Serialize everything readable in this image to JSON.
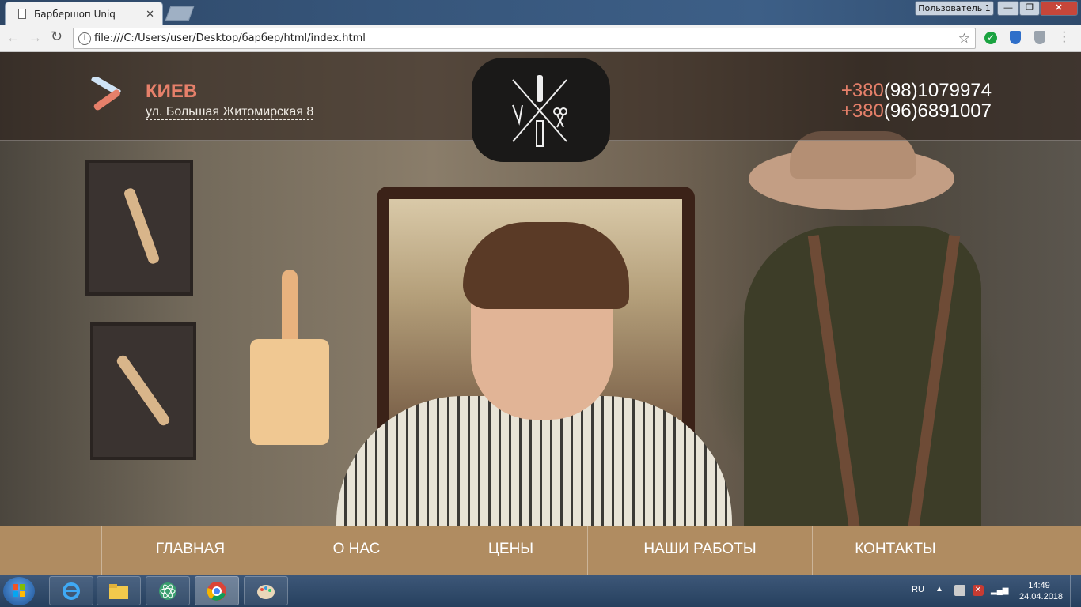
{
  "window": {
    "tab_title": "Барбершоп Uniq",
    "tab_close": "✕",
    "user_label": "Пользователь 1",
    "minimize": "—",
    "maximize": "❐",
    "close": "✕"
  },
  "toolbar": {
    "url": "file:///C:/Users/user/Desktop/барбер/html/index.html",
    "back": "←",
    "forward": "→",
    "reload": "↻",
    "info_icon": "i",
    "star": "☆",
    "ext_check": "✓"
  },
  "header": {
    "city": "КИЕВ",
    "address": "ул. Большая Житомирская 8",
    "phones": [
      {
        "prefix": "+380",
        "number": "(98)1079974"
      },
      {
        "prefix": "+380",
        "number": "(96)6891007"
      }
    ]
  },
  "nav": {
    "items": [
      {
        "label": "ГЛАВНАЯ"
      },
      {
        "label": "О НАС"
      },
      {
        "label": "ЦЕНЫ"
      },
      {
        "label": "НАШИ РАБОТЫ"
      },
      {
        "label": "КОНТАКТЫ"
      }
    ]
  },
  "taskbar": {
    "language": "RU",
    "time": "14:49",
    "date": "24.04.2018",
    "tray_up": "▲",
    "tray_x": "✕",
    "signal": "▂▄▆"
  },
  "colors": {
    "accent_coral": "#e6806a",
    "nav_gold": "#b08c61",
    "header_overlay": "rgba(40,28,22,.55)"
  },
  "icons": {
    "header_logo": "razor-icon",
    "center_logo": "barber-crossed-tools-logo",
    "taskbar": [
      "windows-start-icon",
      "internet-explorer-icon",
      "file-explorer-icon",
      "atom-icon",
      "chrome-icon",
      "paint-icon"
    ]
  }
}
